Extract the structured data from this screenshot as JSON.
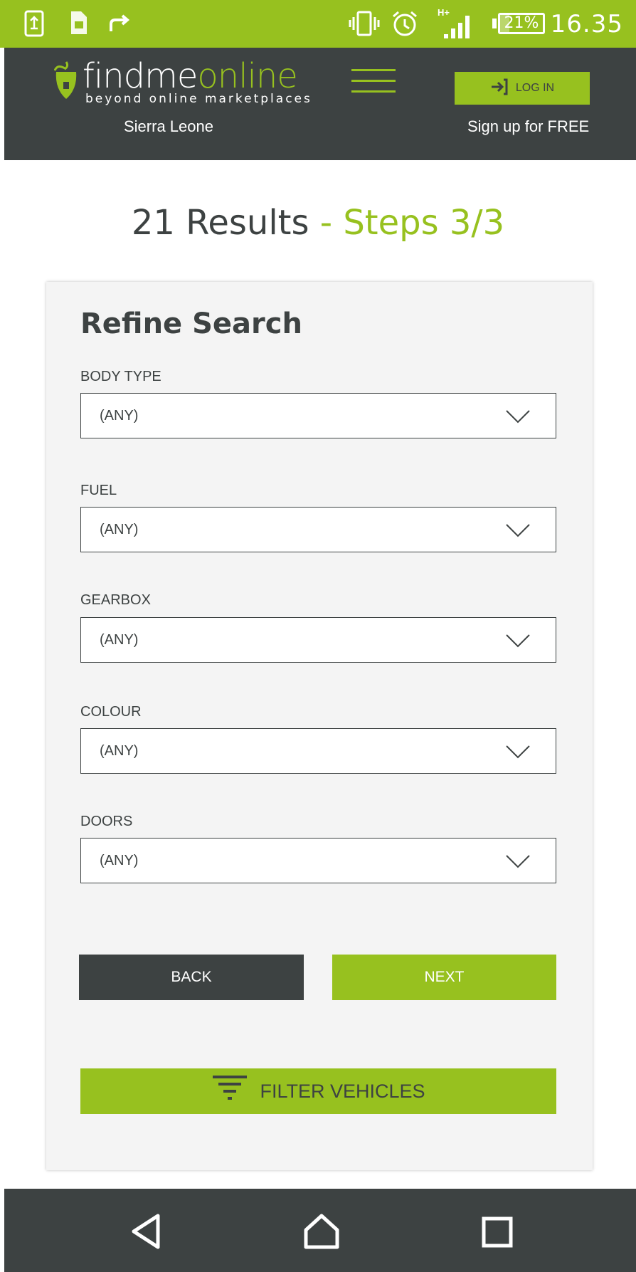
{
  "status_bar": {
    "icons": [
      "screenshot-icon",
      "sim-icon",
      "share-arrow-icon",
      "vibrate-icon",
      "alarm-icon",
      "signal-icon",
      "battery-icon"
    ],
    "network": "H+",
    "battery": "21%",
    "battery_level": 0.21,
    "time": "16.35"
  },
  "header": {
    "logo": {
      "word_main": "findme",
      "word_accent": "online",
      "tagline": "beyond online marketplaces"
    },
    "country": "Sierra Leone",
    "login_label": "LOG IN",
    "signup_label": "Sign up for FREE"
  },
  "results": {
    "count_text": "21 Results",
    "steps_text": " - Steps 3/3"
  },
  "refine": {
    "title": "Refine Search",
    "fields": [
      {
        "label": "BODY TYPE",
        "value": "(ANY)"
      },
      {
        "label": "FUEL",
        "value": "(ANY)"
      },
      {
        "label": "GEARBOX",
        "value": "(ANY)"
      },
      {
        "label": "COLOUR",
        "value": "(ANY)"
      },
      {
        "label": "DOORS",
        "value": "(ANY)"
      }
    ],
    "back_label": "BACK",
    "next_label": "NEXT",
    "filter_label": "FILTER VEHICLES"
  },
  "colors": {
    "brand_green": "#97c11f",
    "dark": "#3d4242",
    "card_bg": "#f4f4f4"
  }
}
